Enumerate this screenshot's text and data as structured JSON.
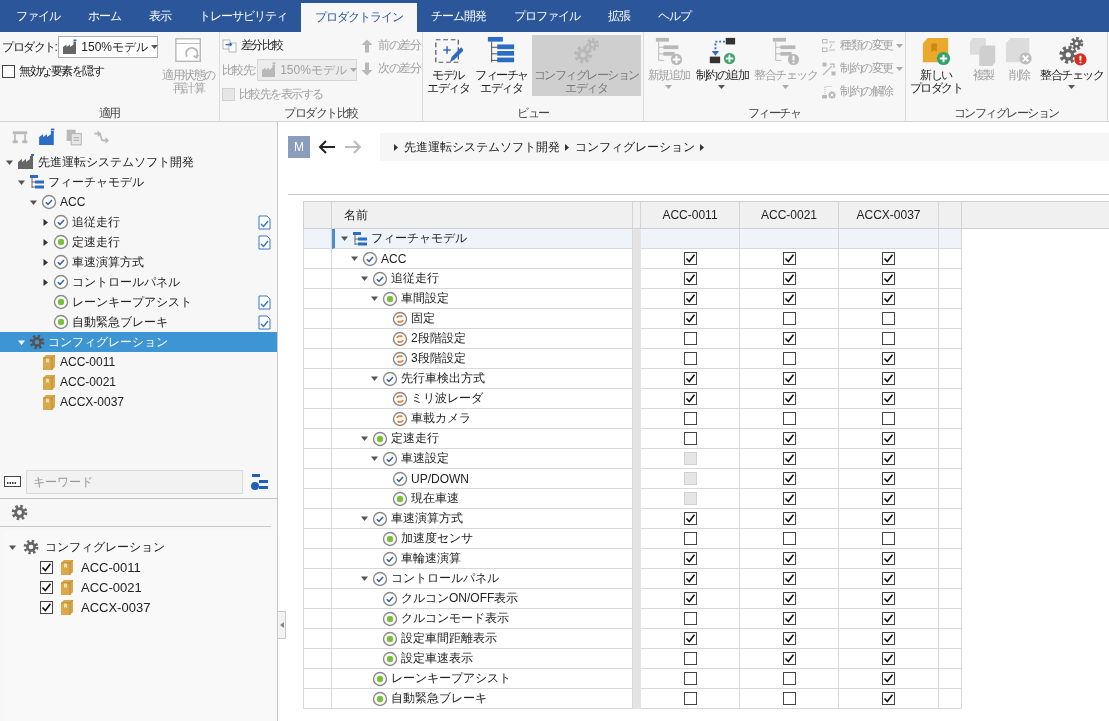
{
  "ribbon": {
    "tabs": [
      {
        "label": "ファイル",
        "selected": false
      },
      {
        "label": "ホーム",
        "selected": false
      },
      {
        "label": "表示",
        "selected": false
      },
      {
        "label": "トレーサビリティ",
        "selected": false
      },
      {
        "label": "プロダクトライン",
        "selected": true
      },
      {
        "label": "チーム開発",
        "selected": false
      },
      {
        "label": "プロファイル",
        "selected": false
      },
      {
        "label": "拡張",
        "selected": false
      },
      {
        "label": "ヘルプ",
        "selected": false
      }
    ],
    "groups": [
      {
        "label": "適用",
        "columns": [
          [
            {
              "kind": "dropdown",
              "label": "プロダクト:",
              "value": "150%モデル",
              "disabled": false
            },
            {
              "kind": "checkbox",
              "label": "無効な要素を隠す",
              "checked": false,
              "disabled": false
            }
          ],
          [
            {
              "kind": "large",
              "lines": [
                "適用状態の",
                "再計算"
              ],
              "disabled": true,
              "menu": false,
              "pressed": false
            }
          ]
        ]
      },
      {
        "label": "プロダクト比較",
        "columns": [
          [
            {
              "kind": "small",
              "label": "差分比較",
              "disabled": false,
              "menu": false
            },
            {
              "kind": "dropdown",
              "label": "比較先:",
              "value": "150%モデル",
              "disabled": true
            },
            {
              "kind": "checkbox",
              "label": "比較先を表示する",
              "checked": false,
              "disabled": true
            }
          ],
          [
            {
              "kind": "small",
              "label": "前の差分",
              "disabled": true,
              "menu": false
            },
            {
              "kind": "small",
              "label": "次の差分",
              "disabled": true,
              "menu": false
            }
          ]
        ]
      },
      {
        "label": "ビュー",
        "columns": [
          [
            {
              "kind": "large",
              "lines": [
                "モデル",
                "エディタ"
              ],
              "disabled": false,
              "menu": false,
              "pressed": false
            }
          ],
          [
            {
              "kind": "large",
              "lines": [
                "フィーチャ",
                "エディタ"
              ],
              "disabled": false,
              "menu": false,
              "pressed": false
            }
          ],
          [
            {
              "kind": "large",
              "lines": [
                "コンフィグレーション",
                "エディタ"
              ],
              "disabled": true,
              "menu": false,
              "pressed": true
            }
          ]
        ]
      },
      {
        "label": "フィーチャ",
        "columns": [
          [
            {
              "kind": "large",
              "lines": [
                "新規追加"
              ],
              "disabled": true,
              "menu": true,
              "pressed": false
            }
          ],
          [
            {
              "kind": "large",
              "lines": [
                "制約の追加"
              ],
              "disabled": false,
              "menu": true,
              "pressed": false
            }
          ],
          [
            {
              "kind": "large",
              "lines": [
                "整合チェック"
              ],
              "disabled": true,
              "menu": true,
              "pressed": false
            }
          ],
          [
            {
              "kind": "small",
              "label": "種類の変更",
              "disabled": true,
              "menu": true
            },
            {
              "kind": "small",
              "label": "制約の変更",
              "disabled": true,
              "menu": true
            },
            {
              "kind": "small",
              "label": "制約の解除",
              "disabled": true,
              "menu": false
            }
          ]
        ]
      },
      {
        "label": "コンフィグレーション",
        "columns": [
          [
            {
              "kind": "large",
              "lines": [
                "新しい",
                "プロダクト"
              ],
              "disabled": false,
              "menu": false,
              "pressed": false
            }
          ],
          [
            {
              "kind": "large",
              "lines": [
                "複製"
              ],
              "disabled": true,
              "menu": false,
              "pressed": false
            }
          ],
          [
            {
              "kind": "large",
              "lines": [
                "削除"
              ],
              "disabled": true,
              "menu": false,
              "pressed": false
            }
          ],
          [
            {
              "kind": "large",
              "lines": [
                "整合チェック"
              ],
              "disabled": false,
              "menu": true,
              "pressed": false
            }
          ]
        ]
      }
    ]
  },
  "explorer": {
    "toolbar": [
      {
        "disabled": true
      },
      {
        "disabled": false
      },
      {
        "disabled": true
      },
      {
        "disabled": true
      }
    ],
    "tree": [
      {
        "label": "先進運転システムソフト開発",
        "kind": "project",
        "expanded": true,
        "selected": false,
        "note": false,
        "children": [
          {
            "label": "フィーチャモデル",
            "kind": "model",
            "expanded": true,
            "selected": false,
            "note": false,
            "children": [
              {
                "label": "ACC",
                "kind": "mandatory",
                "expanded": true,
                "selected": false,
                "note": false,
                "children": [
                  {
                    "label": "追従走行",
                    "kind": "mandatory",
                    "expanded": false,
                    "selected": false,
                    "note": true
                  },
                  {
                    "label": "定速走行",
                    "kind": "optional",
                    "expanded": false,
                    "selected": false,
                    "note": true
                  },
                  {
                    "label": "車速演算方式",
                    "kind": "mandatory",
                    "expanded": false,
                    "selected": false,
                    "note": false
                  },
                  {
                    "label": "コントロールパネル",
                    "kind": "mandatory",
                    "expanded": false,
                    "selected": false,
                    "note": false
                  },
                  {
                    "label": "レーンキープアシスト",
                    "kind": "optional",
                    "selected": false,
                    "note": true
                  },
                  {
                    "label": "自動緊急ブレーキ",
                    "kind": "optional",
                    "selected": false,
                    "note": true
                  }
                ]
              }
            ]
          },
          {
            "label": "コンフィグレーション",
            "kind": "config",
            "expanded": true,
            "selected": true,
            "note": false,
            "children": [
              {
                "label": "ACC-0011",
                "kind": "product",
                "selected": false,
                "note": false
              },
              {
                "label": "ACC-0021",
                "kind": "product",
                "selected": false,
                "note": false
              },
              {
                "label": "ACCX-0037",
                "kind": "product",
                "selected": false,
                "note": false
              }
            ]
          }
        ]
      }
    ],
    "search": {
      "placeholder": "キーワード"
    },
    "configs": {
      "label": "コンフィグレーション",
      "expanded": true,
      "items": [
        {
          "label": "ACC-0011",
          "checked": true
        },
        {
          "label": "ACC-0021",
          "checked": true
        },
        {
          "label": "ACCX-0037",
          "checked": true
        }
      ]
    }
  },
  "breadcrumb": {
    "avatar": "M",
    "crumbs": [
      "先進運転システムソフト開発",
      "コンフィグレーション"
    ]
  },
  "grid": {
    "columns": [
      "名前",
      "ACC-0011",
      "ACC-0021",
      "ACCX-0037"
    ],
    "rows": [
      {
        "label": "フィーチャモデル",
        "kind": "model",
        "expanded": true,
        "selected": true,
        "children": [
          {
            "label": "ACC",
            "kind": "mandatory",
            "expanded": true,
            "selected": false,
            "cells": [
              {
                "checked": true,
                "disabled": false
              },
              {
                "checked": true,
                "disabled": false
              },
              {
                "checked": true,
                "disabled": false
              }
            ],
            "children": [
              {
                "label": "追従走行",
                "kind": "mandatory",
                "expanded": true,
                "selected": false,
                "cells": [
                  {
                    "checked": true,
                    "disabled": false
                  },
                  {
                    "checked": true,
                    "disabled": false
                  },
                  {
                    "checked": true,
                    "disabled": false
                  }
                ],
                "children": [
                  {
                    "label": "車間設定",
                    "kind": "optional",
                    "expanded": true,
                    "selected": false,
                    "cells": [
                      {
                        "checked": true,
                        "disabled": false
                      },
                      {
                        "checked": true,
                        "disabled": false
                      },
                      {
                        "checked": true,
                        "disabled": false
                      }
                    ],
                    "children": [
                      {
                        "label": "固定",
                        "kind": "alternative",
                        "selected": false,
                        "cells": [
                          {
                            "checked": true,
                            "disabled": false
                          },
                          {
                            "checked": false,
                            "disabled": false
                          },
                          {
                            "checked": false,
                            "disabled": false
                          }
                        ]
                      },
                      {
                        "label": "2段階設定",
                        "kind": "alternative",
                        "selected": false,
                        "cells": [
                          {
                            "checked": false,
                            "disabled": false
                          },
                          {
                            "checked": true,
                            "disabled": false
                          },
                          {
                            "checked": false,
                            "disabled": false
                          }
                        ]
                      },
                      {
                        "label": "3段階設定",
                        "kind": "alternative",
                        "selected": false,
                        "cells": [
                          {
                            "checked": false,
                            "disabled": false
                          },
                          {
                            "checked": false,
                            "disabled": false
                          },
                          {
                            "checked": true,
                            "disabled": false
                          }
                        ]
                      }
                    ]
                  },
                  {
                    "label": "先行車検出方式",
                    "kind": "mandatory",
                    "expanded": true,
                    "selected": false,
                    "cells": [
                      {
                        "checked": true,
                        "disabled": false
                      },
                      {
                        "checked": true,
                        "disabled": false
                      },
                      {
                        "checked": true,
                        "disabled": false
                      }
                    ],
                    "children": [
                      {
                        "label": "ミリ波レーダ",
                        "kind": "alternative",
                        "selected": false,
                        "cells": [
                          {
                            "checked": true,
                            "disabled": false
                          },
                          {
                            "checked": true,
                            "disabled": false
                          },
                          {
                            "checked": true,
                            "disabled": false
                          }
                        ]
                      },
                      {
                        "label": "車載カメラ",
                        "kind": "alternative",
                        "selected": false,
                        "cells": [
                          {
                            "checked": false,
                            "disabled": false
                          },
                          {
                            "checked": false,
                            "disabled": false
                          },
                          {
                            "checked": false,
                            "disabled": false
                          }
                        ]
                      }
                    ]
                  }
                ]
              },
              {
                "label": "定速走行",
                "kind": "optional",
                "expanded": true,
                "selected": false,
                "cells": [
                  {
                    "checked": false,
                    "disabled": false
                  },
                  {
                    "checked": true,
                    "disabled": false
                  },
                  {
                    "checked": true,
                    "disabled": false
                  }
                ],
                "children": [
                  {
                    "label": "車速設定",
                    "kind": "mandatory",
                    "expanded": true,
                    "selected": false,
                    "cells": [
                      {
                        "checked": false,
                        "disabled": true
                      },
                      {
                        "checked": true,
                        "disabled": false
                      },
                      {
                        "checked": true,
                        "disabled": false
                      }
                    ],
                    "children": [
                      {
                        "label": "UP/DOWN",
                        "kind": "mandatory",
                        "selected": false,
                        "cells": [
                          {
                            "checked": false,
                            "disabled": true
                          },
                          {
                            "checked": true,
                            "disabled": false
                          },
                          {
                            "checked": true,
                            "disabled": false
                          }
                        ]
                      },
                      {
                        "label": "現在車速",
                        "kind": "optional",
                        "selected": false,
                        "cells": [
                          {
                            "checked": false,
                            "disabled": true
                          },
                          {
                            "checked": true,
                            "disabled": false
                          },
                          {
                            "checked": true,
                            "disabled": false
                          }
                        ]
                      }
                    ]
                  }
                ]
              },
              {
                "label": "車速演算方式",
                "kind": "mandatory",
                "expanded": true,
                "selected": false,
                "cells": [
                  {
                    "checked": true,
                    "disabled": false
                  },
                  {
                    "checked": true,
                    "disabled": false
                  },
                  {
                    "checked": true,
                    "disabled": false
                  }
                ],
                "children": [
                  {
                    "label": "加速度センサ",
                    "kind": "optional",
                    "selected": false,
                    "cells": [
                      {
                        "checked": false,
                        "disabled": false
                      },
                      {
                        "checked": false,
                        "disabled": false
                      },
                      {
                        "checked": false,
                        "disabled": false
                      }
                    ]
                  },
                  {
                    "label": "車輪速演算",
                    "kind": "mandatory",
                    "selected": false,
                    "cells": [
                      {
                        "checked": true,
                        "disabled": false
                      },
                      {
                        "checked": true,
                        "disabled": false
                      },
                      {
                        "checked": true,
                        "disabled": false
                      }
                    ]
                  }
                ]
              },
              {
                "label": "コントロールパネル",
                "kind": "mandatory",
                "expanded": true,
                "selected": false,
                "cells": [
                  {
                    "checked": true,
                    "disabled": false
                  },
                  {
                    "checked": true,
                    "disabled": false
                  },
                  {
                    "checked": true,
                    "disabled": false
                  }
                ],
                "children": [
                  {
                    "label": "クルコンON/OFF表示",
                    "kind": "mandatory",
                    "selected": false,
                    "cells": [
                      {
                        "checked": true,
                        "disabled": false
                      },
                      {
                        "checked": true,
                        "disabled": false
                      },
                      {
                        "checked": true,
                        "disabled": false
                      }
                    ]
                  },
                  {
                    "label": "クルコンモード表示",
                    "kind": "optional",
                    "selected": false,
                    "cells": [
                      {
                        "checked": false,
                        "disabled": false
                      },
                      {
                        "checked": true,
                        "disabled": false
                      },
                      {
                        "checked": true,
                        "disabled": false
                      }
                    ]
                  },
                  {
                    "label": "設定車間距離表示",
                    "kind": "optional",
                    "selected": false,
                    "cells": [
                      {
                        "checked": true,
                        "disabled": false
                      },
                      {
                        "checked": true,
                        "disabled": false
                      },
                      {
                        "checked": true,
                        "disabled": false
                      }
                    ]
                  },
                  {
                    "label": "設定車速表示",
                    "kind": "optional",
                    "selected": false,
                    "cells": [
                      {
                        "checked": false,
                        "disabled": false
                      },
                      {
                        "checked": true,
                        "disabled": false
                      },
                      {
                        "checked": true,
                        "disabled": false
                      }
                    ]
                  }
                ]
              },
              {
                "label": "レーンキープアシスト",
                "kind": "optional",
                "selected": false,
                "cells": [
                  {
                    "checked": false,
                    "disabled": false
                  },
                  {
                    "checked": false,
                    "disabled": false
                  },
                  {
                    "checked": true,
                    "disabled": false
                  }
                ]
              },
              {
                "label": "自動緊急ブレーキ",
                "kind": "optional",
                "selected": false,
                "cells": [
                  {
                    "checked": false,
                    "disabled": false
                  },
                  {
                    "checked": false,
                    "disabled": false
                  },
                  {
                    "checked": true,
                    "disabled": false
                  }
                ]
              }
            ]
          }
        ]
      }
    ]
  }
}
